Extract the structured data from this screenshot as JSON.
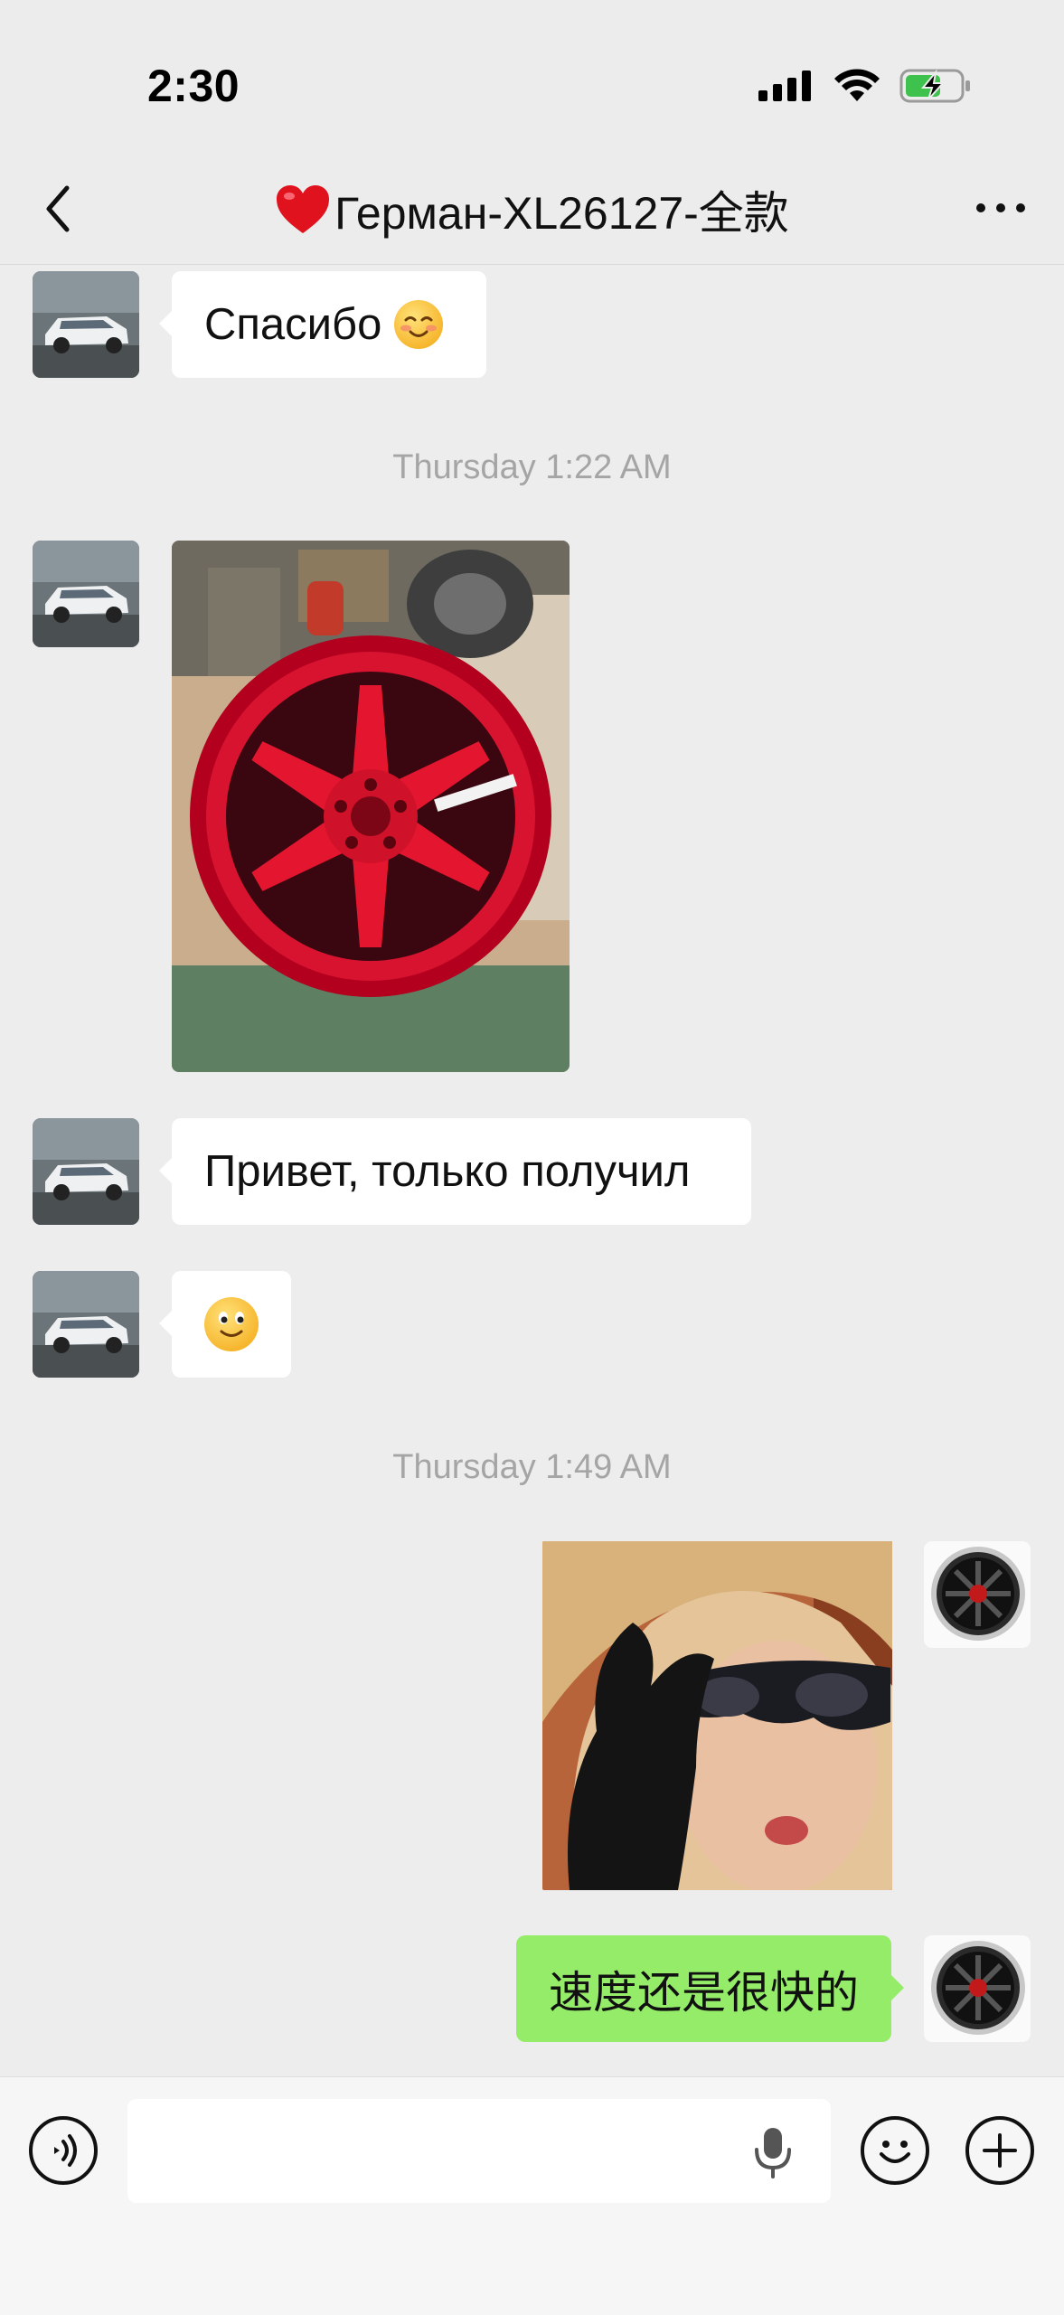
{
  "status_bar": {
    "time": "2:30"
  },
  "nav": {
    "title": "Герман-XL26127-全款"
  },
  "messages": [
    {
      "direction": "incoming",
      "type": "text",
      "text": "Спасибо"
    },
    {
      "type": "timestamp",
      "text": "Thursday 1:22 AM"
    },
    {
      "direction": "incoming",
      "type": "image",
      "description_icon": "red-wheel-photo"
    },
    {
      "direction": "incoming",
      "type": "text",
      "text": "Привет, только получил"
    },
    {
      "direction": "incoming",
      "type": "emoji",
      "icon": "smile-emoji"
    },
    {
      "type": "timestamp",
      "text": "Thursday 1:49 AM"
    },
    {
      "direction": "outgoing",
      "type": "image",
      "description_icon": "sticker-photo"
    },
    {
      "direction": "outgoing",
      "type": "text",
      "text": "速度还是很快的"
    }
  ],
  "input": {
    "value": "",
    "placeholder": ""
  },
  "colors": {
    "outgoing_bubble": "#95ec69",
    "incoming_bubble": "#ffffff",
    "background": "#ededed"
  }
}
